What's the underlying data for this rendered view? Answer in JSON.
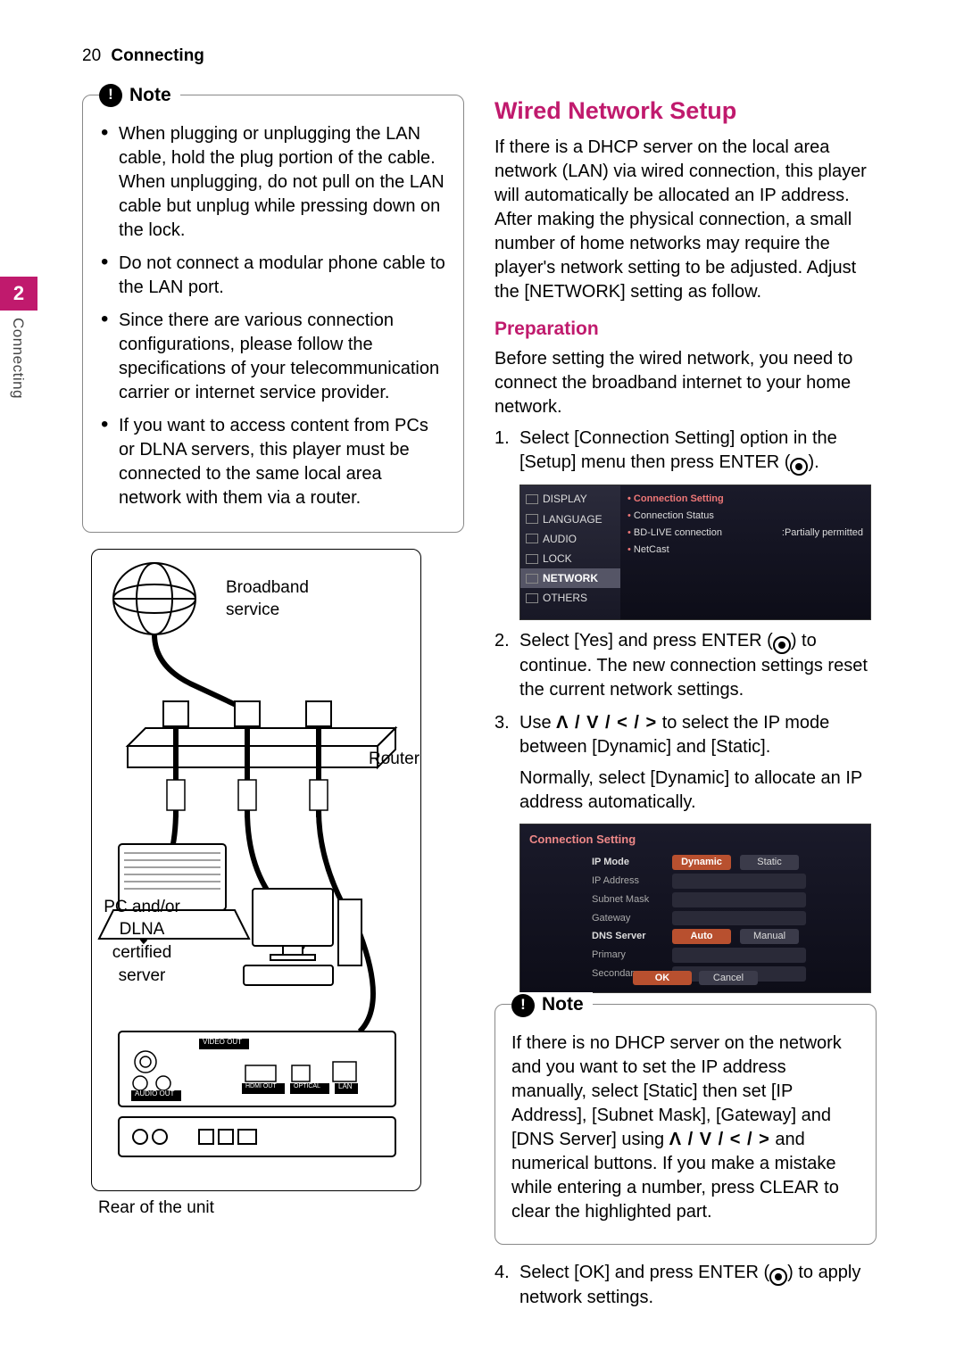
{
  "header": {
    "page_number": "20",
    "section": "Connecting"
  },
  "side_tab": {
    "number": "2",
    "label": "Connecting"
  },
  "left": {
    "note_title": "Note",
    "note_bullets": [
      "When plugging or unplugging the LAN cable, hold the plug portion of the cable. When unplugging, do not pull on the LAN cable but unplug while pressing down on the lock.",
      "Do not connect a modular phone cable to the LAN port.",
      "Since there are various connection configurations, please follow the specifications of your telecommunication carrier or internet service provider.",
      "If you want to access content from PCs or DLNA servers, this player must be connected to the same local area network with them via a router."
    ],
    "diagram": {
      "broadband_label_l1": "Broadband",
      "broadband_label_l2": "service",
      "router_label": "Router",
      "server_label_l1": "PC and/or",
      "server_label_l2": "DLNA certified",
      "server_label_l3": "server",
      "caption": "Rear of the unit",
      "ports": {
        "video_out": "VIDEO OUT",
        "audio_out": "AUDIO OUT",
        "hdmi_out": "HDMI OUT",
        "optical": "OPTICAL",
        "lan": "LAN"
      }
    }
  },
  "right": {
    "title": "Wired Network Setup",
    "intro": "If there is a DHCP server on the local area network (LAN) via wired connection, this player will automatically be allocated an IP address. After making the physical connection, a small number of home networks may require the player's network setting to be adjusted. Adjust the [NETWORK] setting as follow.",
    "prep_title": "Preparation",
    "prep_body": "Before setting the wired network, you need to connect the broadband internet to your home network.",
    "steps": {
      "s1_a": "Select [Connection Setting] option in the [Setup] menu then press ENTER (",
      "s1_b": ").",
      "s2_a": "Select [Yes] and press ENTER (",
      "s2_b": ") to continue. The new connection settings reset the current network settings.",
      "s3_a": "Use ",
      "s3_arrows": "Λ / V / < / >",
      "s3_b": " to select the IP mode between [Dynamic] and [Static].",
      "s3_c": "Normally, select [Dynamic] to allocate an IP address automatically.",
      "s4_a": "Select [OK] and press ENTER (",
      "s4_b": ") to apply network settings."
    },
    "setup_menu": {
      "items": [
        "DISPLAY",
        "LANGUAGE",
        "AUDIO",
        "LOCK",
        "NETWORK",
        "OTHERS"
      ],
      "selected": "NETWORK",
      "right_items": [
        {
          "label": "Connection Setting",
          "highlight": true,
          "value": ""
        },
        {
          "label": "Connection Status",
          "highlight": false,
          "value": ""
        },
        {
          "label": "BD-LIVE connection",
          "highlight": false,
          "value": ":Partially permitted"
        },
        {
          "label": "NetCast",
          "highlight": false,
          "value": ""
        }
      ]
    },
    "conn_setting": {
      "title": "Connection Setting",
      "rows": [
        {
          "label": "IP Mode",
          "opts": [
            "Dynamic",
            "Static"
          ],
          "sel": 0,
          "bold": true
        },
        {
          "label": "IP Address"
        },
        {
          "label": "Subnet Mask"
        },
        {
          "label": "Gateway"
        },
        {
          "label": "DNS Server",
          "opts": [
            "Auto",
            "Manual"
          ],
          "sel": 0,
          "bold": true
        },
        {
          "label": "Primary"
        },
        {
          "label": "Secondary"
        }
      ],
      "buttons": [
        "OK",
        "Cancel"
      ]
    },
    "note2_title": "Note",
    "note2_body_a": "If there is no DHCP server on the network and you want to set the IP address manually, select [Static] then set [IP Address], [Subnet Mask], [Gateway] and [DNS Server] using ",
    "note2_arrows": "Λ / V / < / >",
    "note2_body_b": " and numerical buttons. If you make a mistake while entering a number, press CLEAR to clear the highlighted part."
  }
}
